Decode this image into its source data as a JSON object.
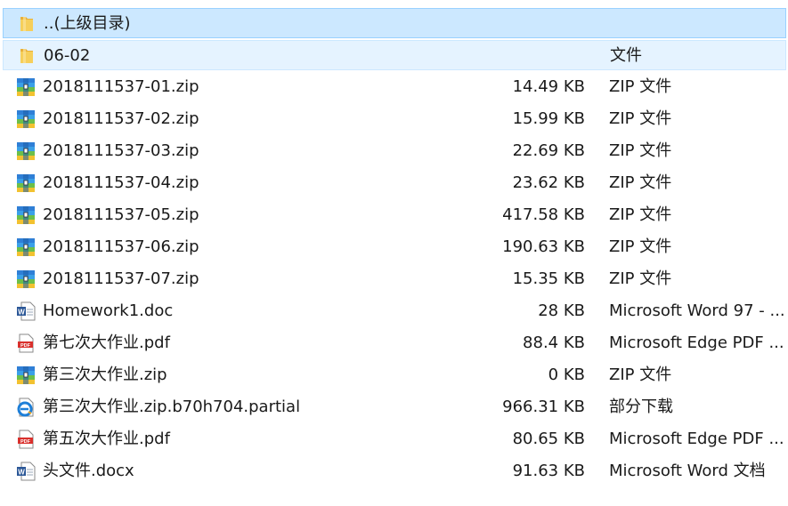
{
  "rows": [
    {
      "name": "..(上级目录)",
      "size": "",
      "type": "",
      "icon": "folder-icon",
      "state": "selected"
    },
    {
      "name": "06-02",
      "size": "",
      "type": "文件",
      "icon": "folder-icon",
      "state": "hover"
    },
    {
      "name": "2018111537-01.zip",
      "size": "14.49 KB",
      "type": "ZIP 文件",
      "icon": "zip-archive-icon"
    },
    {
      "name": "2018111537-02.zip",
      "size": "15.99 KB",
      "type": "ZIP 文件",
      "icon": "zip-archive-icon"
    },
    {
      "name": "2018111537-03.zip",
      "size": "22.69 KB",
      "type": "ZIP 文件",
      "icon": "zip-archive-icon"
    },
    {
      "name": "2018111537-04.zip",
      "size": "23.62 KB",
      "type": "ZIP 文件",
      "icon": "zip-archive-icon"
    },
    {
      "name": "2018111537-05.zip",
      "size": "417.58 KB",
      "type": "ZIP 文件",
      "icon": "zip-archive-icon"
    },
    {
      "name": "2018111537-06.zip",
      "size": "190.63 KB",
      "type": "ZIP 文件",
      "icon": "zip-archive-icon"
    },
    {
      "name": "2018111537-07.zip",
      "size": "15.35 KB",
      "type": "ZIP 文件",
      "icon": "zip-archive-icon"
    },
    {
      "name": "Homework1.doc",
      "size": "28 KB",
      "type": "Microsoft Word 97 - ...",
      "icon": "word-doc-icon"
    },
    {
      "name": "第七次大作业.pdf",
      "size": "88.4 KB",
      "type": "Microsoft Edge PDF ...",
      "icon": "pdf-icon"
    },
    {
      "name": "第三次大作业.zip",
      "size": "0 KB",
      "type": "ZIP 文件",
      "icon": "zip-archive-icon"
    },
    {
      "name": "第三次大作业.zip.b70h704.partial",
      "size": "966.31 KB",
      "type": "部分下载",
      "icon": "edge-partial-download-icon"
    },
    {
      "name": "第五次大作业.pdf",
      "size": "80.65 KB",
      "type": "Microsoft Edge PDF ...",
      "icon": "pdf-icon"
    },
    {
      "name": "头文件.docx",
      "size": "91.63 KB",
      "type": "Microsoft Word 文档",
      "icon": "word-doc-icon"
    }
  ]
}
